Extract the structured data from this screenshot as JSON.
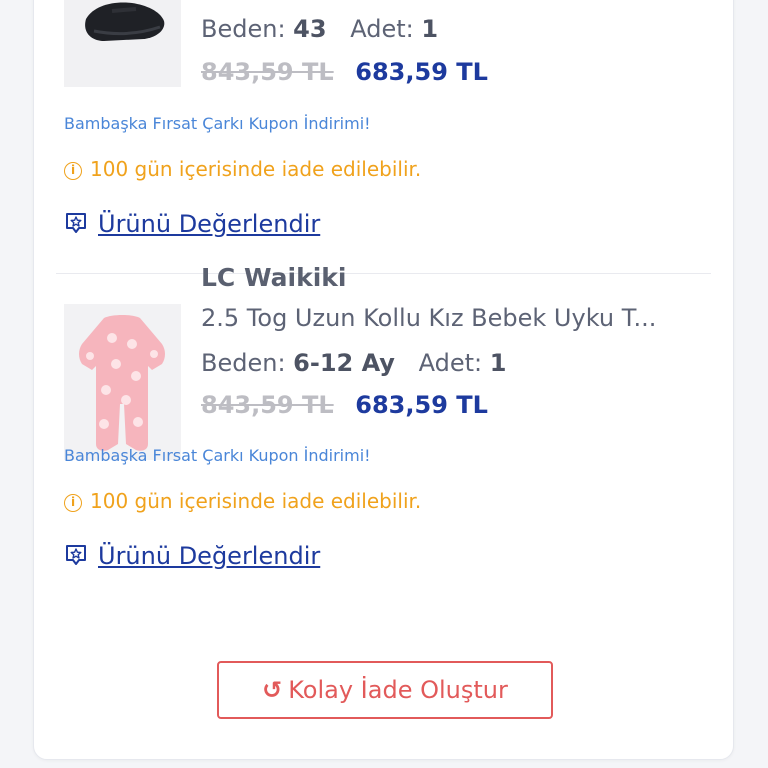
{
  "items": [
    {
      "brand": "",
      "title": "",
      "size_label": "Beden:",
      "size_value": "43",
      "qty_label": "Adet:",
      "qty_value": "1",
      "old_price": "843,59 TL",
      "new_price": "683,59 TL",
      "coupon": "Bambaşka Fırsat Çarkı Kupon İndirimi!",
      "return_notice": "100 gün içerisinde iade edilebilir.",
      "review_link": "Ürünü Değerlendir",
      "thumb_icon": "black-sneaker-image"
    },
    {
      "brand": "LC Waikiki",
      "title": "2.5 Tog Uzun Kollu Kız Bebek Uyku T...",
      "size_label": "Beden:",
      "size_value": "6-12 Ay",
      "qty_label": "Adet:",
      "qty_value": "1",
      "old_price": "843,59 TL",
      "new_price": "683,59 TL",
      "coupon": "Bambaşka Fırsat Çarkı Kupon İndirimi!",
      "return_notice": "100 gün içerisinde iade edilebilir.",
      "review_link": "Ürünü Değerlendir",
      "thumb_icon": "pink-baby-sleepsuit-image"
    }
  ],
  "actions": {
    "easy_return_label": "Kolay İade Oluştur",
    "easy_return_icon": "undo-icon"
  },
  "colors": {
    "accent_blue": "#1d3a9e",
    "link_blue": "#4a86d8",
    "warning_orange": "#f0a21c",
    "danger_red": "#e25a5a"
  }
}
